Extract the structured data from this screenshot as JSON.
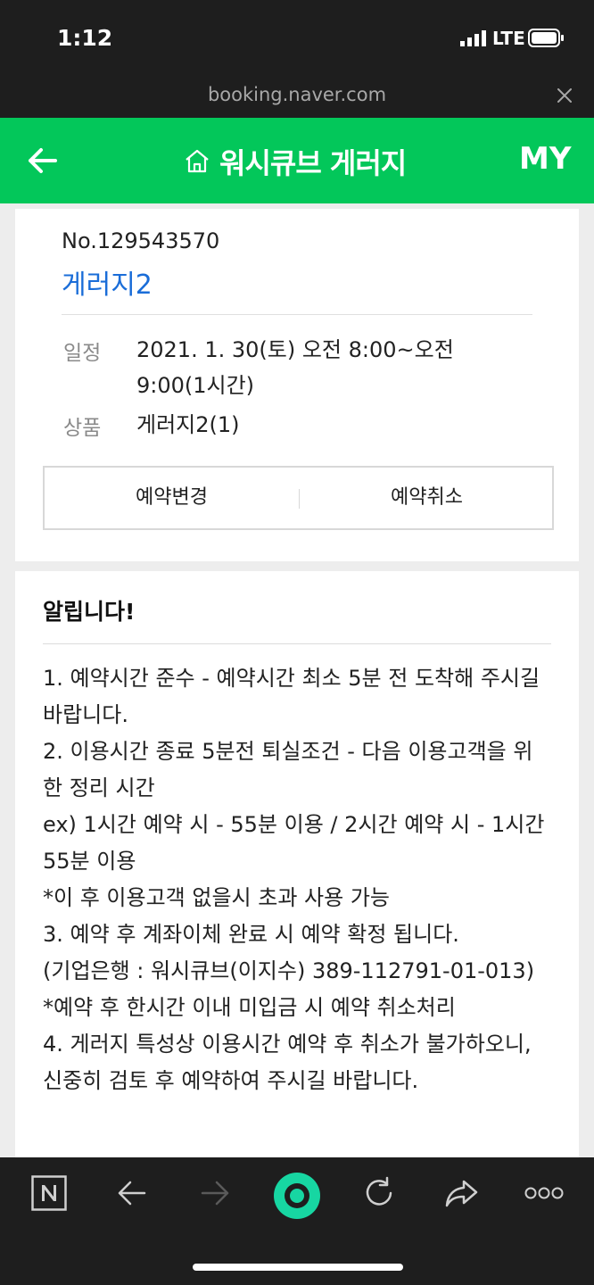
{
  "status_bar": {
    "time": "1:12",
    "network": "LTE"
  },
  "url_bar": {
    "url": "booking.naver.com"
  },
  "header": {
    "title": "워시큐브 게러지",
    "my": "MY"
  },
  "reservation": {
    "number": "No.129543570",
    "product_name": "게러지2",
    "schedule_label": "일정",
    "schedule_value": "2021. 1. 30(토) 오전 8:00~오전 9:00(1시간)",
    "item_label": "상품",
    "item_value": "게러지2(1)",
    "change_button": "예약변경",
    "cancel_button": "예약취소"
  },
  "notice": {
    "title": "알립니다!",
    "lines": [
      "1. 예약시간 준수 - 예약시간 최소 5분 전 도착해 주시길 바랍니다.",
      "2. 이용시간 종료 5분전 퇴실조건 - 다음 이용고객을 위한 정리 시간",
      "ex) 1시간 예약 시 - 55분 이용 / 2시간 예약 시 - 1시간 55분 이용",
      "*이 후 이용고객 없을시 초과 사용 가능",
      "3. 예약 후 계좌이체 완료 시 예약 확정 됩니다.",
      "(기업은행 : 워시큐브(이지수) 389-112791-01-013)",
      "*예약 후 한시간 이내 미입금 시 예약 취소처리",
      "4. 게러지 특성상 이용시간 예약 후 취소가 불가하오니, 신중히 검토 후 예약하여 주시길 바랍니다."
    ]
  },
  "colors": {
    "brand_green": "#03c75a",
    "link_blue": "#1a6dd8",
    "toolbar_dark": "#1e1e1e"
  },
  "toolbar_icons": [
    "naver-n-icon",
    "back-arrow-icon",
    "forward-arrow-icon",
    "green-dot-icon",
    "refresh-icon",
    "share-icon",
    "more-icon"
  ]
}
